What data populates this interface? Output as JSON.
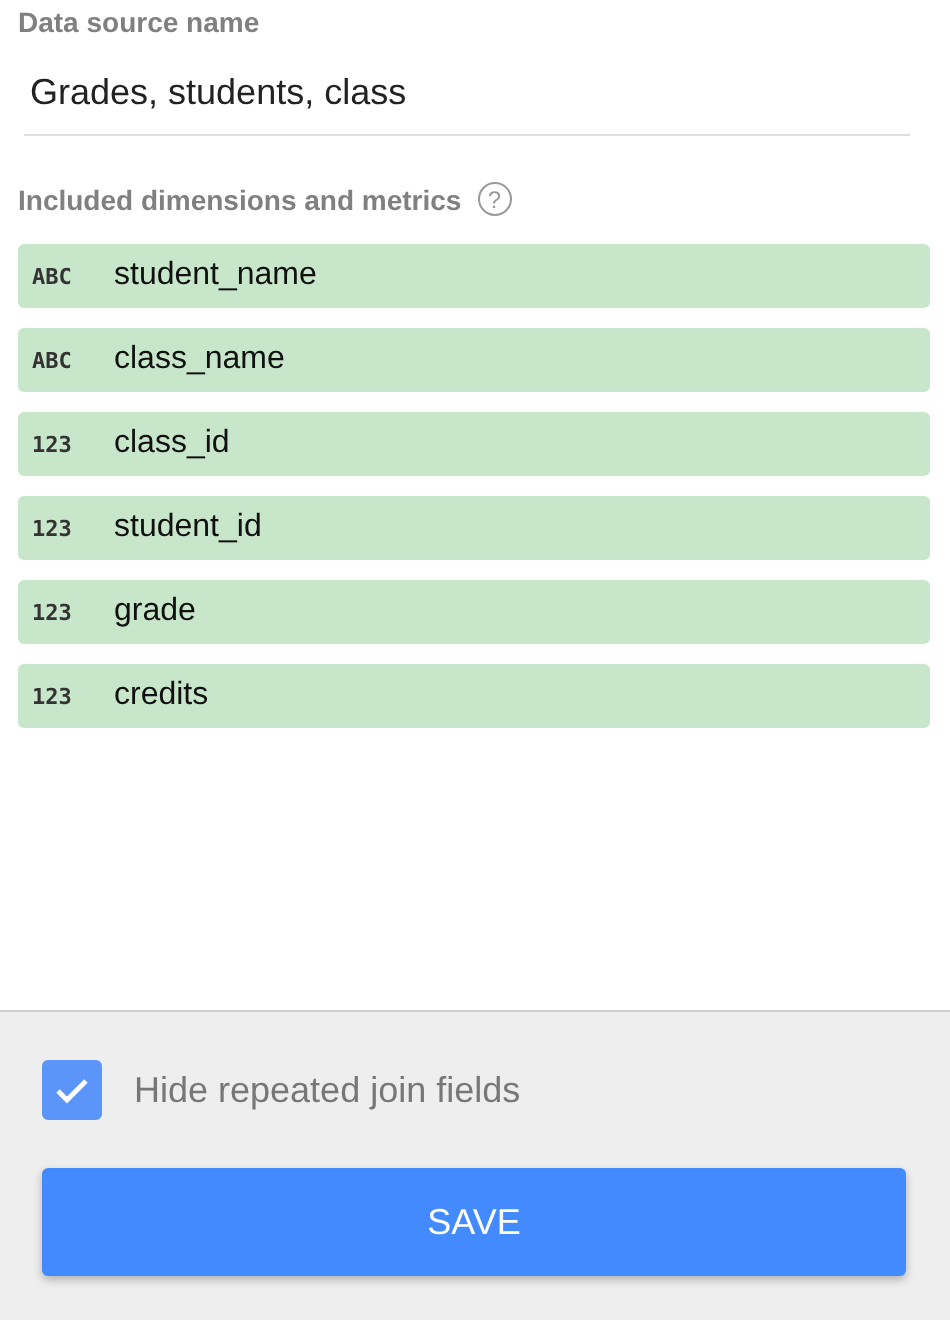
{
  "data_source_name": {
    "label": "Data source name",
    "value": "Grades, students, class"
  },
  "fields_section": {
    "heading": "Included dimensions and metrics",
    "help_icon": "?"
  },
  "fields": [
    {
      "type_label": "ABC",
      "name": "student_name"
    },
    {
      "type_label": "ABC",
      "name": "class_name"
    },
    {
      "type_label": "123",
      "name": "class_id"
    },
    {
      "type_label": "123",
      "name": "student_id"
    },
    {
      "type_label": "123",
      "name": "grade"
    },
    {
      "type_label": "123",
      "name": "credits"
    }
  ],
  "footer": {
    "checkbox": {
      "label": "Hide repeated join fields",
      "checked": true
    },
    "save_button": "SAVE"
  }
}
